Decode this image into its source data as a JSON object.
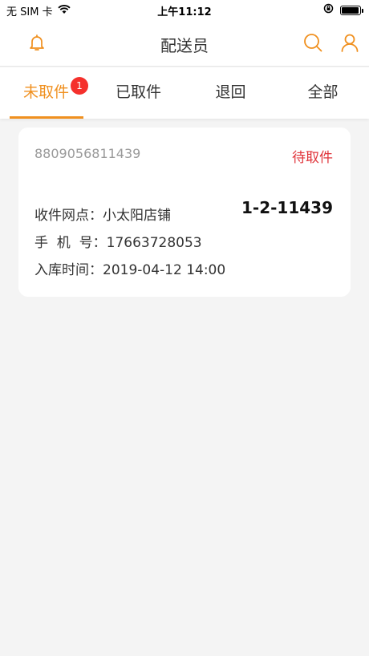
{
  "status_bar": {
    "carrier": "无 SIM 卡",
    "time": "上午11:12",
    "battery_level": 0.95
  },
  "header": {
    "title": "配送员",
    "left_icon": "bell-icon",
    "right_icons": [
      "search-icon",
      "user-icon"
    ]
  },
  "tabs": [
    {
      "label": "未取件",
      "badge": "1",
      "active": true
    },
    {
      "label": "已取件",
      "active": false
    },
    {
      "label": "退回",
      "active": false
    },
    {
      "label": "全部",
      "active": false
    }
  ],
  "order": {
    "number": "8809056811439",
    "status": "待取件",
    "pickup_code": "1-2-11439",
    "station_label": "收件网点：",
    "station_value": "小太阳店铺",
    "phone_label": "手  机  号：",
    "phone_value": "17663728053",
    "time_label": "入库时间：",
    "time_value": "2019-04-12 14:00"
  },
  "colors": {
    "accent": "#f0901f",
    "status_red": "#e0343a",
    "badge_red": "#f5302c",
    "background": "#f4f4f4"
  }
}
